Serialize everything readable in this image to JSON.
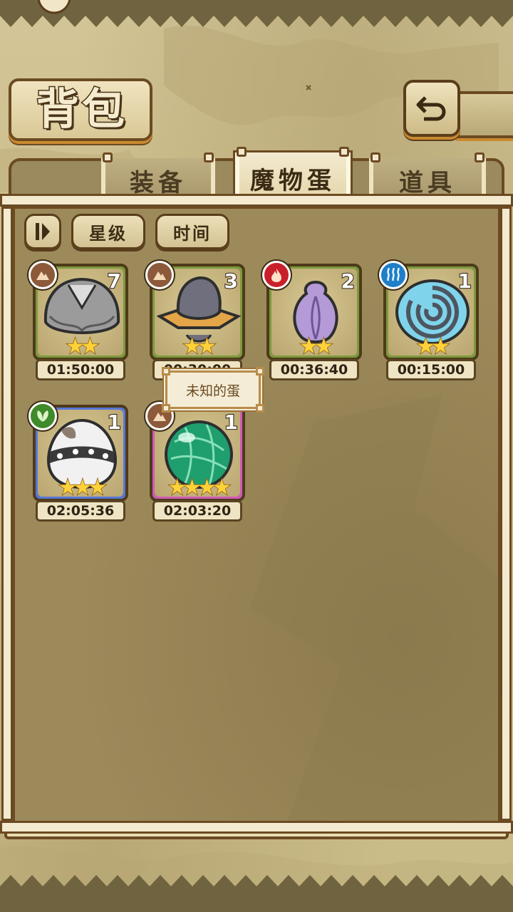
{
  "header": {
    "title": "背包",
    "back_icon": "return-arrow-icon"
  },
  "tabs": [
    {
      "label": "装备",
      "active": false
    },
    {
      "label": "魔物蛋",
      "active": true
    },
    {
      "label": "道具",
      "active": false
    }
  ],
  "sort": {
    "toggle_icon": "sort-order-icon",
    "star_label": "星级",
    "time_label": "时间"
  },
  "eggs": [
    {
      "element": "earth",
      "count": "7",
      "stars": 2,
      "stars_text": "★★",
      "timer": "01:50:00",
      "rarity": "green"
    },
    {
      "element": "earth",
      "count": "3",
      "stars": 2,
      "stars_text": "★★",
      "timer": "00:30:00",
      "rarity": "green"
    },
    {
      "element": "fire",
      "count": "2",
      "stars": 2,
      "stars_text": "★★",
      "timer": "00:36:40",
      "rarity": "green"
    },
    {
      "element": "water",
      "count": "1",
      "stars": 2,
      "stars_text": "★★",
      "timer": "00:15:00",
      "rarity": "green"
    },
    {
      "element": "leaf",
      "count": "1",
      "stars": 3,
      "stars_text": "★★★",
      "timer": "02:05:36",
      "rarity": "blue"
    },
    {
      "element": "earth",
      "count": "1",
      "stars": 4,
      "stars_text": "★★★★",
      "timer": "02:03:20",
      "rarity": "pink"
    }
  ],
  "tooltip": {
    "text": "未知的蛋"
  },
  "colors": {
    "accent": "#c9892f",
    "frame": "#6b4a22",
    "green": "#7c9a3d",
    "blue": "#5876d6",
    "pink": "#d05ab7"
  }
}
